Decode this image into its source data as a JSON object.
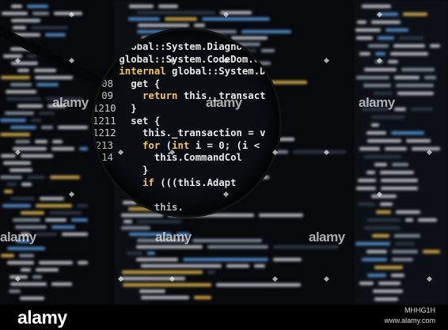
{
  "lens_lines": [
    {
      "num": "",
      "tokens": [
        {
          "t": "global::System.Diagnos",
          "c": "wh"
        }
      ]
    },
    {
      "num": "",
      "tokens": [
        {
          "t": "global::System.CodeDom.Co",
          "c": "wh"
        }
      ]
    },
    {
      "num": "",
      "tokens": [
        {
          "t": "internal ",
          "c": "kw"
        },
        {
          "t": "global::System.Dat",
          "c": "wh"
        }
      ]
    },
    {
      "num": "08",
      "tokens": [
        {
          "t": "  get {",
          "c": "wh"
        }
      ]
    },
    {
      "num": "09",
      "tokens": [
        {
          "t": "    ",
          "c": "wh"
        },
        {
          "t": "return ",
          "c": "kw"
        },
        {
          "t": "this._transact",
          "c": "wh"
        }
      ]
    },
    {
      "num": "1210",
      "tokens": [
        {
          "t": "  }",
          "c": "wh"
        }
      ]
    },
    {
      "num": "1211",
      "tokens": [
        {
          "t": "  set {",
          "c": "wh"
        }
      ]
    },
    {
      "num": "1212",
      "tokens": [
        {
          "t": "    ",
          "c": "wh"
        },
        {
          "t": "this._transaction = v",
          "c": "wh"
        }
      ]
    },
    {
      "num": "213",
      "tokens": [
        {
          "t": "    ",
          "c": "wh"
        },
        {
          "t": "for ",
          "c": "kw"
        },
        {
          "t": "(",
          "c": "wh"
        },
        {
          "t": "int ",
          "c": "kw"
        },
        {
          "t": "i = 0; (i <",
          "c": "wh"
        }
      ]
    },
    {
      "num": "14",
      "tokens": [
        {
          "t": "      this.CommandCol",
          "c": "wh"
        }
      ]
    },
    {
      "num": "",
      "tokens": [
        {
          "t": "    }",
          "c": "wh"
        }
      ]
    },
    {
      "num": "",
      "tokens": [
        {
          "t": "    ",
          "c": "wh"
        },
        {
          "t": "if ",
          "c": "kw"
        },
        {
          "t": "(((this.Adapt",
          "c": "wh"
        }
      ]
    },
    {
      "num": "",
      "tokens": [
        {
          "t": "",
          "c": "wh"
        }
      ]
    },
    {
      "num": "",
      "tokens": [
        {
          "t": "      this.",
          "c": "wh"
        }
      ]
    }
  ],
  "watermarks": [
    "alamy",
    "alamy",
    "alamy",
    "alamy",
    "alamy",
    "alamy"
  ],
  "bottom_bar": {
    "logo": "alamy",
    "image_id": "MHHG1H",
    "url": "www.alamy.com"
  },
  "colors": {
    "keyword": "#f5c84a",
    "identifier": "#eaeaea",
    "type": "#5a9fe6",
    "background": "#07090d"
  }
}
